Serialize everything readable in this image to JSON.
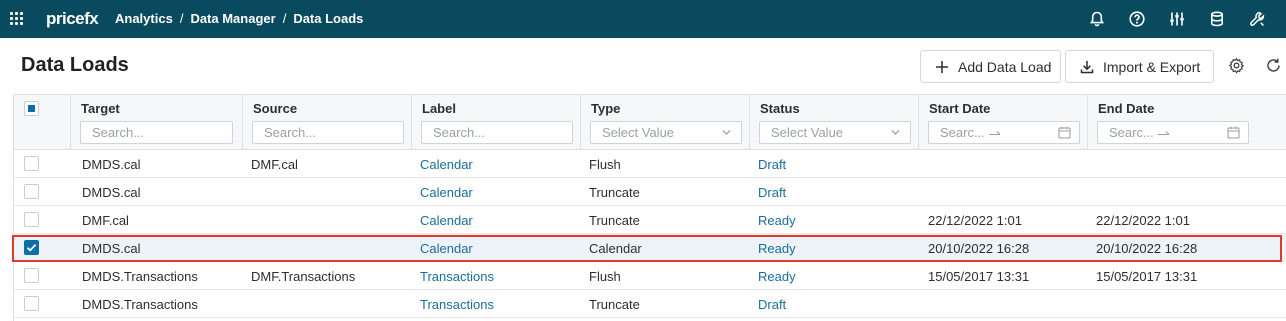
{
  "app": {
    "logo_text": "pricefx",
    "breadcrumbs": [
      "Analytics",
      "Data Manager",
      "Data Loads"
    ],
    "breadcrumb_sep": "/",
    "topbar_icons": [
      "bell-icon",
      "help-icon",
      "sliders-icon",
      "database-icon",
      "wrench-icon"
    ]
  },
  "page": {
    "title": "Data Loads",
    "add_label": "Add Data Load",
    "import_label": "Import & Export"
  },
  "columns": [
    {
      "key": "target",
      "label": "Target",
      "filter": "Search..."
    },
    {
      "key": "source",
      "label": "Source",
      "filter": "Search..."
    },
    {
      "key": "label",
      "label": "Label",
      "filter": "Search..."
    },
    {
      "key": "type",
      "label": "Type",
      "filter": "Select Value"
    },
    {
      "key": "status",
      "label": "Status",
      "filter": "Select Value"
    },
    {
      "key": "start",
      "label": "Start Date",
      "filter": "Searc..."
    },
    {
      "key": "end",
      "label": "End Date",
      "filter": "Searc..."
    }
  ],
  "rows": [
    {
      "target": "DMDS.cal",
      "source": "DMF.cal",
      "label": "Calendar",
      "type": "Flush",
      "status": "Draft",
      "start": "",
      "end": "",
      "checked": false
    },
    {
      "target": "DMDS.cal",
      "source": "",
      "label": "Calendar",
      "type": "Truncate",
      "status": "Draft",
      "start": "",
      "end": "",
      "checked": false
    },
    {
      "target": "DMF.cal",
      "source": "",
      "label": "Calendar",
      "type": "Truncate",
      "status": "Ready",
      "start": "22/12/2022 1:01",
      "end": "22/12/2022 1:01",
      "checked": false
    },
    {
      "target": "DMDS.cal",
      "source": "",
      "label": "Calendar",
      "type": "Calendar",
      "status": "Ready",
      "start": "20/10/2022 16:28",
      "end": "20/10/2022 16:28",
      "checked": true
    },
    {
      "target": "DMDS.Transactions",
      "source": "DMF.Transactions",
      "label": "Transactions",
      "type": "Flush",
      "status": "Ready",
      "start": "15/05/2017 13:31",
      "end": "15/05/2017 13:31",
      "checked": false
    },
    {
      "target": "DMDS.Transactions",
      "source": "",
      "label": "Transactions",
      "type": "Truncate",
      "status": "Draft",
      "start": "",
      "end": "",
      "checked": false
    }
  ],
  "colors": {
    "topbar": "#0a4a5f",
    "link": "#1a6e9a",
    "accent": "#0d6da8",
    "selection_outline": "#e03a2b"
  }
}
